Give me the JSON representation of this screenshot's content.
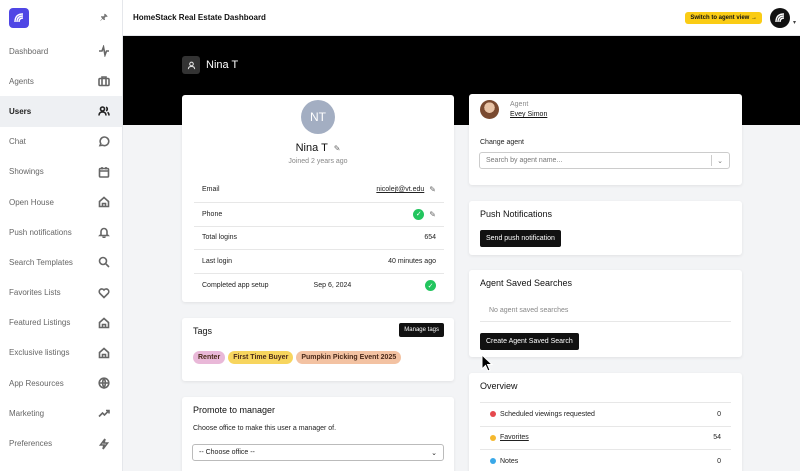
{
  "sidebar": {
    "items": [
      {
        "label": "Dashboard",
        "icon": "activity-icon"
      },
      {
        "label": "Agents",
        "icon": "briefcase-icon"
      },
      {
        "label": "Users",
        "icon": "users-icon"
      },
      {
        "label": "Chat",
        "icon": "chat-icon"
      },
      {
        "label": "Showings",
        "icon": "calendar-icon"
      },
      {
        "label": "Open House",
        "icon": "home-icon"
      },
      {
        "label": "Push notifications",
        "icon": "bell-icon"
      },
      {
        "label": "Search Templates",
        "icon": "search-icon"
      },
      {
        "label": "Favorites Lists",
        "icon": "heart-icon"
      },
      {
        "label": "Featured Listings",
        "icon": "home-icon"
      },
      {
        "label": "Exclusive listings",
        "icon": "home-icon"
      },
      {
        "label": "App Resources",
        "icon": "globe-icon"
      },
      {
        "label": "Marketing",
        "icon": "trending-icon"
      },
      {
        "label": "Preferences",
        "icon": "bolt-icon"
      }
    ]
  },
  "header": {
    "title": "HomeStack Real Estate Dashboard",
    "switch_label": "Switch to agent view →"
  },
  "hero": {
    "user_name": "Nina T"
  },
  "profile": {
    "initials": "NT",
    "name": "Nina T",
    "joined": "Joined 2 years ago",
    "rows": {
      "email": {
        "label": "Email",
        "value": "nicolejt@vt.edu"
      },
      "phone": {
        "label": "Phone"
      },
      "logins": {
        "label": "Total logins",
        "value": "654"
      },
      "last_login": {
        "label": "Last login",
        "value": "40 minutes ago"
      },
      "setup": {
        "label": "Completed app setup",
        "value": "Sep 6, 2024"
      }
    }
  },
  "tags": {
    "title": "Tags",
    "manage_label": "Manage tags",
    "items": [
      {
        "label": "Renter",
        "color": "#e9b8d8"
      },
      {
        "label": "First Time Buyer",
        "color": "#f7d55e"
      },
      {
        "label": "Pumpkin Picking Event 2025",
        "color": "#f3c2a2"
      }
    ]
  },
  "promote": {
    "title": "Promote to manager",
    "description": "Choose office to make this user a manager of.",
    "select_value": "-- Choose office --"
  },
  "agent": {
    "label": "Agent",
    "name": "Evey Simon",
    "change_label": "Change agent",
    "search_placeholder": "Search by agent name..."
  },
  "push": {
    "title": "Push Notifications",
    "button_label": "Send push notification"
  },
  "saved_searches": {
    "title": "Agent Saved Searches",
    "empty_text": "No agent saved searches",
    "create_label": "Create Agent Saved Search"
  },
  "overview": {
    "title": "Overview",
    "rows": [
      {
        "label": "Scheduled viewings requested",
        "count": "0",
        "color": "#e5484d"
      },
      {
        "label": "Favorites",
        "count": "54",
        "color": "#f5b82e"
      },
      {
        "label": "Notes",
        "count": "0",
        "color": "#3aa8e8"
      }
    ]
  }
}
